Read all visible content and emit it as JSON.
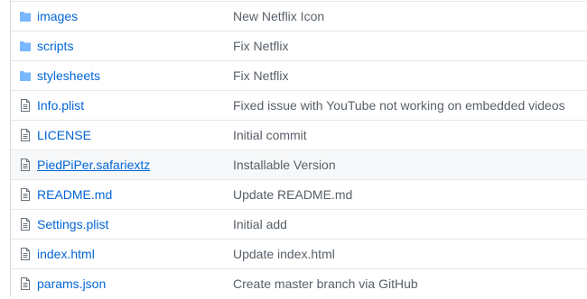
{
  "files": [
    {
      "name": "images",
      "type": "folder",
      "message": "New Netflix Icon",
      "icon": "folder-icon"
    },
    {
      "name": "scripts",
      "type": "folder",
      "message": "Fix Netflix",
      "icon": "folder-icon"
    },
    {
      "name": "stylesheets",
      "type": "folder",
      "message": "Fix Netflix",
      "icon": "folder-icon"
    },
    {
      "name": "Info.plist",
      "type": "file",
      "message": "Fixed issue with YouTube not working on embedded videos",
      "icon": "file-icon"
    },
    {
      "name": "LICENSE",
      "type": "file",
      "message": "Initial commit",
      "icon": "file-icon"
    },
    {
      "name": "PiedPiPer.safariextz",
      "type": "file",
      "message": "Installable Version",
      "icon": "file-icon",
      "hovered": true
    },
    {
      "name": "README.md",
      "type": "file",
      "message": "Update README.md",
      "icon": "file-icon"
    },
    {
      "name": "Settings.plist",
      "type": "file",
      "message": "Initial add",
      "icon": "file-icon"
    },
    {
      "name": "index.html",
      "type": "file",
      "message": "Update index.html",
      "icon": "file-icon"
    },
    {
      "name": "params.json",
      "type": "file",
      "message": "Create master branch via GitHub",
      "icon": "file-icon"
    }
  ],
  "colors": {
    "link": "#0366d6",
    "message": "#586069",
    "folder": "#79b8ff",
    "file_icon": "#6a737d",
    "row_hover": "#f6f8fa"
  }
}
